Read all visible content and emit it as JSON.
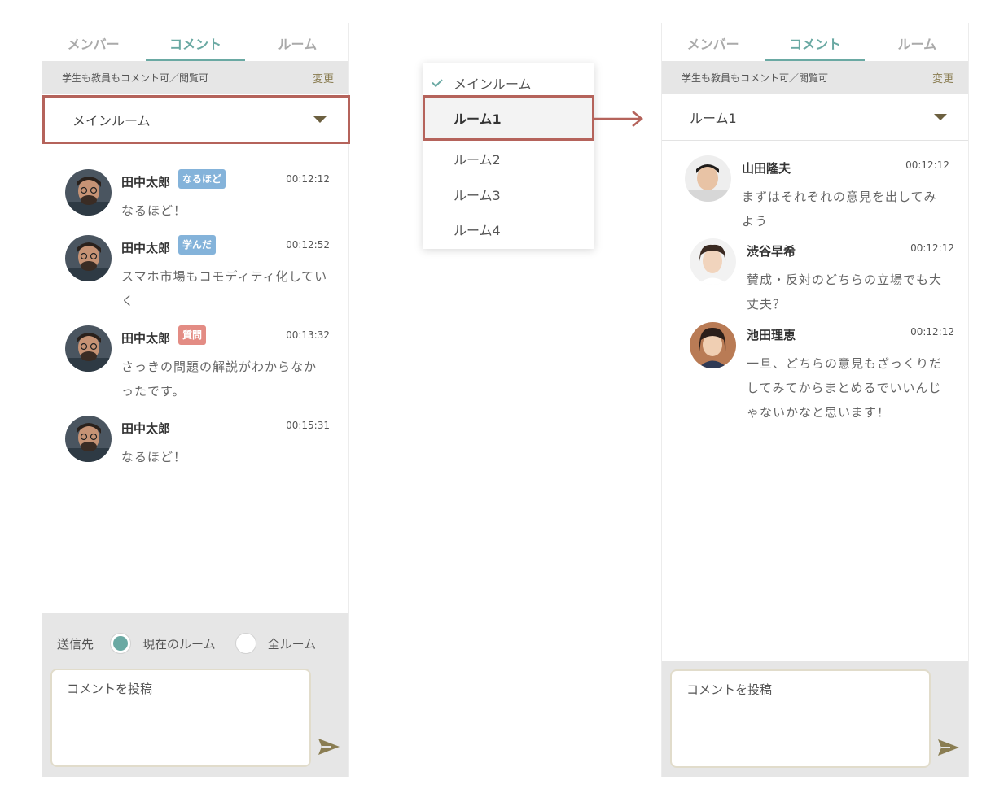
{
  "tabs": [
    "メンバー",
    "コメント",
    "ルーム"
  ],
  "permission": {
    "text": "学生も教員もコメント可／閲覧可",
    "change_label": "変更"
  },
  "left_panel": {
    "room": "メインルーム",
    "comments": [
      {
        "name": "田中太郎",
        "badge": "なるほど",
        "badge_color": "#84b3da",
        "time": "00:12:12",
        "text": "なるほど！"
      },
      {
        "name": "田中太郎",
        "badge": "学んだ",
        "badge_color": "#84b3da",
        "time": "00:12:52",
        "text": "スマホ市場もコモディティ化していく"
      },
      {
        "name": "田中太郎",
        "badge": "質問",
        "badge_color": "#e38c84",
        "time": "00:13:32",
        "text": "さっきの問題の解説がわからなかったです。"
      },
      {
        "name": "田中太郎",
        "badge": "",
        "badge_color": "",
        "time": "00:15:31",
        "text": "なるほど！"
      }
    ],
    "send_to_label": "送信先",
    "current_room_label": "現在のルーム",
    "all_rooms_label": "全ルーム",
    "comment_placeholder": "コメントを投稿"
  },
  "dropdown": {
    "items": [
      "メインルーム",
      "ルーム1",
      "ルーム2",
      "ルーム3",
      "ルーム4"
    ],
    "checked": "メインルーム",
    "highlighted": "ルーム1"
  },
  "right_panel": {
    "room": "ルーム1",
    "comments": [
      {
        "name": "山田隆夫",
        "time": "00:12:12",
        "text": "まずはそれぞれの意見を出してみよう"
      },
      {
        "name": "渋谷早希",
        "time": "00:12:12",
        "text": "賛成・反対のどちらの立場でも大丈夫？"
      },
      {
        "name": "池田理恵",
        "time": "00:12:12",
        "text": "一旦、どちらの意見もざっくりだしてみてからまとめるでいいんじゃないかなと思います！"
      }
    ],
    "comment_placeholder": "コメントを投稿"
  },
  "colors": {
    "accent": "#6aa9a3",
    "highlight_border": "#b5635b",
    "brown": "#8a7d52"
  },
  "icons": [
    "caret-down-icon",
    "check-icon",
    "send-icon",
    "arrow-right-icon",
    "avatar-photo"
  ]
}
